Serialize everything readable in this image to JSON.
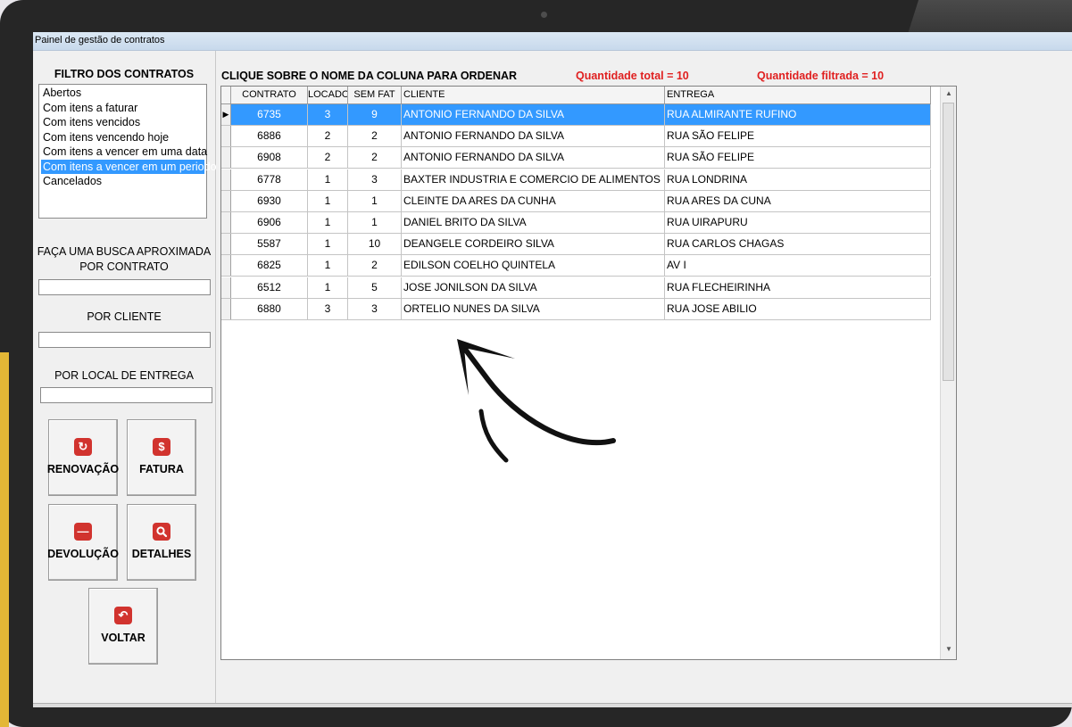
{
  "window": {
    "title": "Painel de gestão de contratos"
  },
  "filters": {
    "heading": "FILTRO DOS CONTRATOS",
    "items": [
      "Abertos",
      "Com itens a faturar",
      "Com itens vencidos",
      "Com itens vencendo hoje",
      "Com itens a vencer em uma data",
      "Com itens a vencer em um periodo",
      "Cancelados"
    ],
    "selected_index": 5
  },
  "search": {
    "heading": "FAÇA UMA BUSCA APROXIMADA",
    "contract_label": "POR CONTRATO",
    "contract_value": "",
    "client_label": "POR CLIENTE",
    "client_value": "",
    "location_label": "POR LOCAL DE ENTREGA",
    "location_value": ""
  },
  "buttons": {
    "renewal": "RENOVAÇÃO",
    "invoice": "FATURA",
    "return": "DEVOLUÇÃO",
    "details": "DETALHES",
    "back": "VOLTAR"
  },
  "icons": {
    "renewal": "refresh-icon",
    "invoice": "dollar-icon",
    "return": "minus-icon",
    "details": "magnifier-icon",
    "back": "undo-icon",
    "icon_color": "#d1332e"
  },
  "grid": {
    "heading": "CLIQUE SOBRE O NOME DA COLUNA PARA ORDENAR",
    "total_label": "Quantidade total = 10",
    "filtered_label": "Quantidade filtrada = 10",
    "columns": [
      "CONTRATO",
      "LOCADO",
      "SEM FAT",
      "CLIENTE",
      "ENTREGA"
    ],
    "rows": [
      [
        "6735",
        "3",
        "9",
        "ANTONIO FERNANDO DA SILVA",
        "RUA ALMIRANTE RUFINO"
      ],
      [
        "6886",
        "2",
        "2",
        "ANTONIO FERNANDO DA SILVA",
        "RUA SÃO FELIPE"
      ],
      [
        "6908",
        "2",
        "2",
        "ANTONIO FERNANDO DA SILVA",
        "RUA SÃO FELIPE"
      ],
      [
        "6778",
        "1",
        "3",
        "BAXTER INDUSTRIA E COMERCIO DE ALIMENTOS LTDA",
        "RUA LONDRINA"
      ],
      [
        "6930",
        "1",
        "1",
        "CLEINTE DA ARES DA CUNHA",
        "RUA ARES DA CUNA"
      ],
      [
        "6906",
        "1",
        "1",
        "DANIEL BRITO DA SILVA",
        "RUA UIRAPURU"
      ],
      [
        "5587",
        "1",
        "10",
        "DEANGELE CORDEIRO SILVA",
        "RUA CARLOS CHAGAS"
      ],
      [
        "6825",
        "1",
        "2",
        "EDILSON COELHO QUINTELA",
        "AV I"
      ],
      [
        "6512",
        "1",
        "5",
        "JOSE JONILSON DA SILVA",
        "RUA FLECHEIRINHA"
      ],
      [
        "6880",
        "3",
        "3",
        "ORTELIO NUNES DA SILVA",
        "RUA JOSE ABILIO"
      ]
    ],
    "selected_row": 0,
    "row_marker": "▶",
    "selection_color": "#3399ff"
  },
  "colors": {
    "accent": "#3399ff",
    "counter_text": "#e02020"
  }
}
